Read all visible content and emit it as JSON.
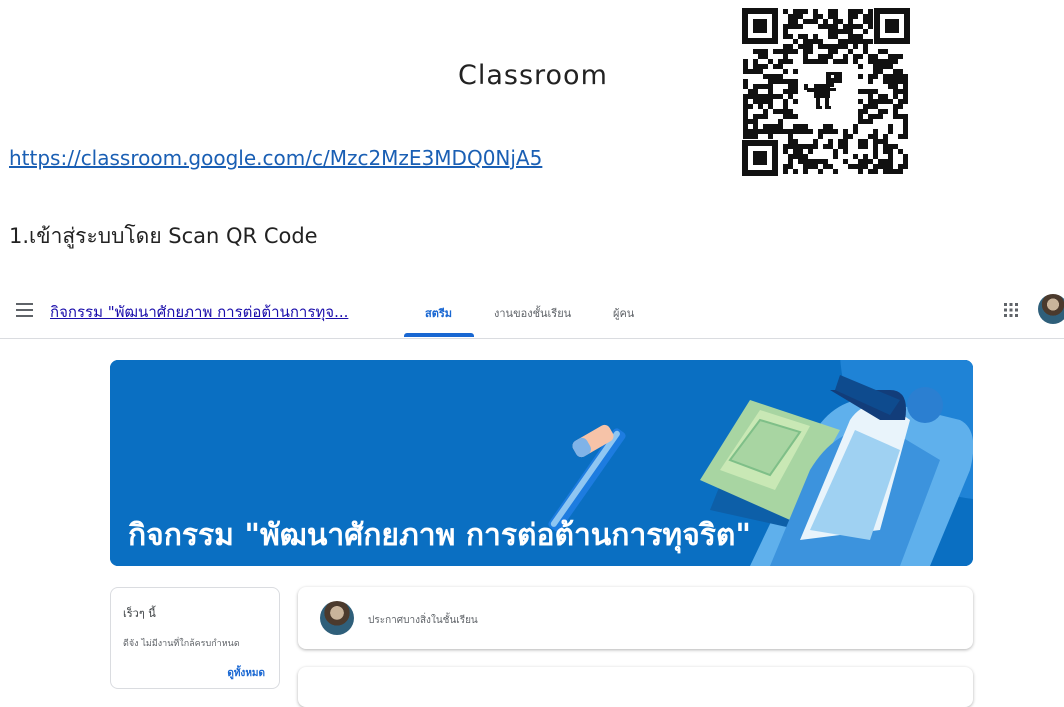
{
  "doc": {
    "title": "Classroom",
    "link": "https://classroom.google.com/c/Mzc2MzE3MDQ0NjA5",
    "step": "1.เข้าสู่ระบบโดย Scan QR Code"
  },
  "qr": {
    "icon": "qr-code-with-dinosaur"
  },
  "classroom": {
    "course_name": "กิจกรรม \"พัฒนาศักยภาพ การต่อต้านการทุจ...",
    "tabs": [
      {
        "label": "สตรีม",
        "active": true
      },
      {
        "label": "งานของชั้นเรียน",
        "active": false
      },
      {
        "label": "ผู้คน",
        "active": false
      }
    ],
    "banner_title": "กิจกรรม \"พัฒนาศักยภาพ การต่อต้านการทุจริต\"",
    "upcoming": {
      "heading": "เร็วๆ นี้",
      "text": "ดีจัง ไม่มีงานที่ใกล้ครบกำหนด",
      "view_all": "ดูทั้งหมด"
    },
    "announce_placeholder": "ประกาศบางสิ่งในชั้นเรียน"
  },
  "colors": {
    "banner": "#0a6fc2",
    "accent": "#1967d2",
    "link": "#1a5fb4"
  }
}
